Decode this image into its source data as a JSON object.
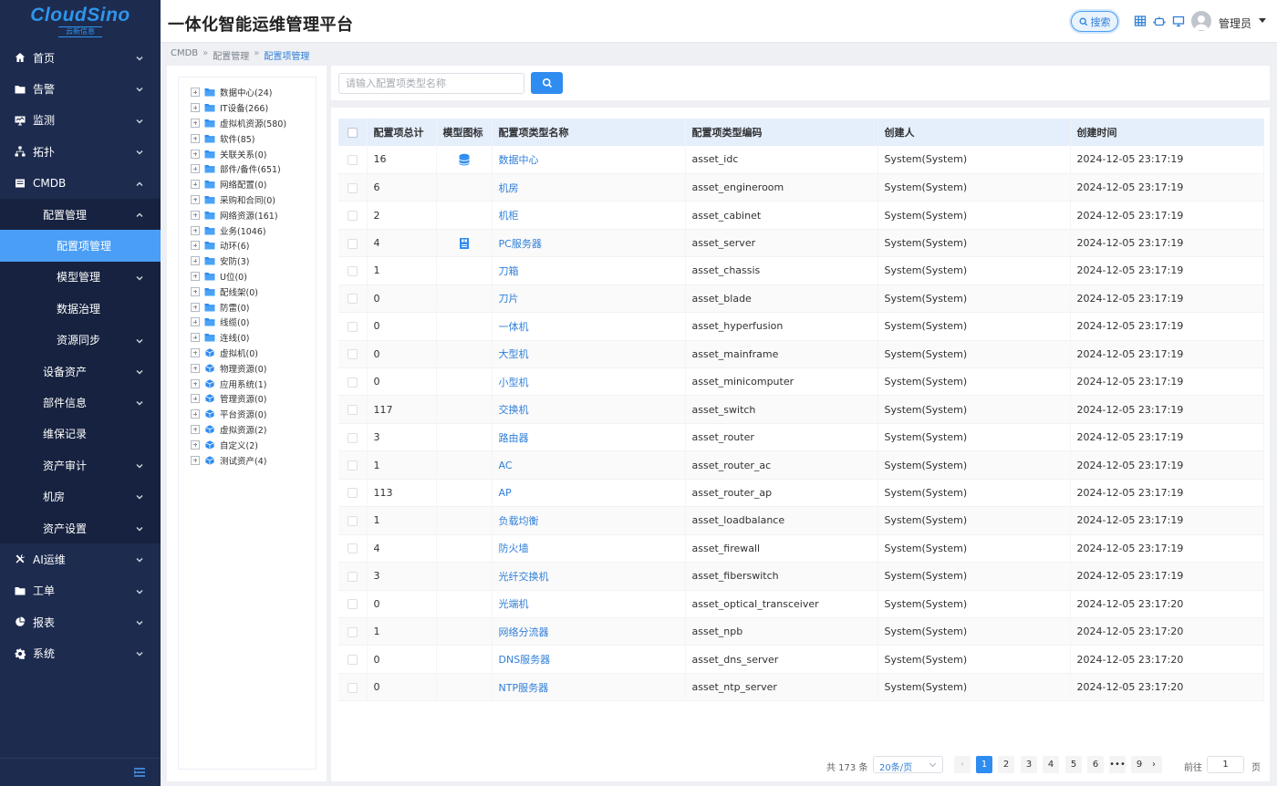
{
  "brand": {
    "logo_text": "CloudSino",
    "logo_sub": "云新信息"
  },
  "header": {
    "title": "一体化智能运维管理平台",
    "search_label": "搜索",
    "user": "管理员"
  },
  "breadcrumb": [
    "CMDB",
    "配置管理",
    "配置项管理"
  ],
  "sidebar": {
    "items": [
      {
        "label": "首页",
        "icon": "home-icon"
      },
      {
        "label": "告警",
        "icon": "folder-icon"
      },
      {
        "label": "监测",
        "icon": "monitor-icon"
      },
      {
        "label": "拓扑",
        "icon": "topology-icon"
      },
      {
        "label": "CMDB",
        "icon": "database-icon"
      },
      {
        "label": "AI运维",
        "icon": "tools-icon"
      },
      {
        "label": "工单",
        "icon": "folder-icon"
      },
      {
        "label": "报表",
        "icon": "pie-chart-icon"
      },
      {
        "label": "系统",
        "icon": "gear-icon"
      }
    ],
    "cmdb_sub": [
      "配置管理",
      "设备资产",
      "部件信息",
      "维保记录",
      "资产审计",
      "机房",
      "资产设置"
    ],
    "config_sub": [
      "配置项管理",
      "模型管理",
      "数据治理",
      "资源同步"
    ]
  },
  "tree": [
    {
      "label": "数据中心(24)",
      "type": "folder"
    },
    {
      "label": "IT设备(266)",
      "type": "folder"
    },
    {
      "label": "虚拟机资源(580)",
      "type": "folder"
    },
    {
      "label": "软件(85)",
      "type": "folder"
    },
    {
      "label": "关联关系(0)",
      "type": "folder"
    },
    {
      "label": "部件/备件(651)",
      "type": "folder"
    },
    {
      "label": "网络配置(0)",
      "type": "folder"
    },
    {
      "label": "采购和合同(0)",
      "type": "folder"
    },
    {
      "label": "网络资源(161)",
      "type": "folder"
    },
    {
      "label": "业务(1046)",
      "type": "folder"
    },
    {
      "label": "动环(6)",
      "type": "folder"
    },
    {
      "label": "安防(3)",
      "type": "folder"
    },
    {
      "label": "U位(0)",
      "type": "folder"
    },
    {
      "label": "配线架(0)",
      "type": "folder"
    },
    {
      "label": "防雷(0)",
      "type": "folder"
    },
    {
      "label": "线缆(0)",
      "type": "folder"
    },
    {
      "label": "连线(0)",
      "type": "folder"
    },
    {
      "label": "虚拟机(0)",
      "type": "cube"
    },
    {
      "label": "物理资源(0)",
      "type": "cube"
    },
    {
      "label": "应用系统(1)",
      "type": "cube"
    },
    {
      "label": "管理资源(0)",
      "type": "cube"
    },
    {
      "label": "平台资源(0)",
      "type": "cube"
    },
    {
      "label": "虚拟资源(2)",
      "type": "cube"
    },
    {
      "label": "自定义(2)",
      "type": "cube"
    },
    {
      "label": "测试资产(4)",
      "type": "cube"
    }
  ],
  "search": {
    "placeholder": "请输入配置项类型名称",
    "value": ""
  },
  "table": {
    "headers": [
      "配置项总计",
      "模型图标",
      "配置项类型名称",
      "配置项类型编码",
      "创建人",
      "创建时间"
    ],
    "rows": [
      {
        "count": "16",
        "icon": "database-icon",
        "name": "数据中心",
        "code": "asset_idc",
        "creator": "System(System)",
        "time": "2024-12-05 23:17:19"
      },
      {
        "count": "6",
        "icon": "",
        "name": "机房",
        "code": "asset_engineroom",
        "creator": "System(System)",
        "time": "2024-12-05 23:17:19"
      },
      {
        "count": "2",
        "icon": "",
        "name": "机柜",
        "code": "asset_cabinet",
        "creator": "System(System)",
        "time": "2024-12-05 23:17:19"
      },
      {
        "count": "4",
        "icon": "server-icon",
        "name": "PC服务器",
        "code": "asset_server",
        "creator": "System(System)",
        "time": "2024-12-05 23:17:19"
      },
      {
        "count": "1",
        "icon": "",
        "name": "刀箱",
        "code": "asset_chassis",
        "creator": "System(System)",
        "time": "2024-12-05 23:17:19"
      },
      {
        "count": "0",
        "icon": "",
        "name": "刀片",
        "code": "asset_blade",
        "creator": "System(System)",
        "time": "2024-12-05 23:17:19"
      },
      {
        "count": "0",
        "icon": "",
        "name": "一体机",
        "code": "asset_hyperfusion",
        "creator": "System(System)",
        "time": "2024-12-05 23:17:19"
      },
      {
        "count": "0",
        "icon": "",
        "name": "大型机",
        "code": "asset_mainframe",
        "creator": "System(System)",
        "time": "2024-12-05 23:17:19"
      },
      {
        "count": "0",
        "icon": "",
        "name": "小型机",
        "code": "asset_minicomputer",
        "creator": "System(System)",
        "time": "2024-12-05 23:17:19"
      },
      {
        "count": "117",
        "icon": "",
        "name": "交换机",
        "code": "asset_switch",
        "creator": "System(System)",
        "time": "2024-12-05 23:17:19"
      },
      {
        "count": "3",
        "icon": "",
        "name": "路由器",
        "code": "asset_router",
        "creator": "System(System)",
        "time": "2024-12-05 23:17:19"
      },
      {
        "count": "1",
        "icon": "",
        "name": "AC",
        "code": "asset_router_ac",
        "creator": "System(System)",
        "time": "2024-12-05 23:17:19"
      },
      {
        "count": "113",
        "icon": "",
        "name": "AP",
        "code": "asset_router_ap",
        "creator": "System(System)",
        "time": "2024-12-05 23:17:19"
      },
      {
        "count": "1",
        "icon": "",
        "name": "负载均衡",
        "code": "asset_loadbalance",
        "creator": "System(System)",
        "time": "2024-12-05 23:17:19"
      },
      {
        "count": "4",
        "icon": "",
        "name": "防火墙",
        "code": "asset_firewall",
        "creator": "System(System)",
        "time": "2024-12-05 23:17:19"
      },
      {
        "count": "3",
        "icon": "",
        "name": "光纤交换机",
        "code": "asset_fiberswitch",
        "creator": "System(System)",
        "time": "2024-12-05 23:17:19"
      },
      {
        "count": "0",
        "icon": "",
        "name": "光端机",
        "code": "asset_optical_transceiver",
        "creator": "System(System)",
        "time": "2024-12-05 23:17:20"
      },
      {
        "count": "1",
        "icon": "",
        "name": "网络分流器",
        "code": "asset_npb",
        "creator": "System(System)",
        "time": "2024-12-05 23:17:20"
      },
      {
        "count": "0",
        "icon": "",
        "name": "DNS服务器",
        "code": "asset_dns_server",
        "creator": "System(System)",
        "time": "2024-12-05 23:17:20"
      },
      {
        "count": "0",
        "icon": "",
        "name": "NTP服务器",
        "code": "asset_ntp_server",
        "creator": "System(System)",
        "time": "2024-12-05 23:17:20"
      }
    ]
  },
  "pager": {
    "total": "共 173 条",
    "page_size": "20条/页",
    "pages": [
      "1",
      "2",
      "3",
      "4",
      "5",
      "6",
      "•••",
      "9"
    ],
    "current": "1",
    "goto_label": "前往",
    "goto_value": "1",
    "page_unit": "页"
  },
  "colors": {
    "sidebar_bg": "#1d2b4f",
    "accent": "#2f8cf0",
    "active_menu": "#4a9ef5"
  }
}
